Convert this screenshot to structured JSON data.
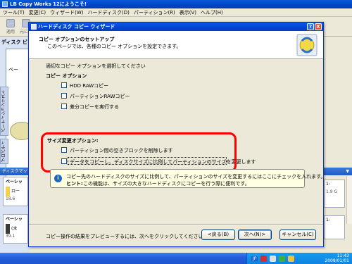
{
  "app": {
    "title": "LB Copy Works 12にようこそ!",
    "menu": [
      "ツール(T)",
      "変更(C)",
      "ウィザード(W)",
      "ハードディスク(D)",
      "パーティション(R)",
      "表示(V)",
      "ヘルプ(H)"
    ],
    "toolbar": {
      "apply": "適用",
      "undo": "元に戻"
    },
    "left_heading": "ディスク ビ",
    "side_tabs": {
      "partition_list": "パーティションリスト",
      "properties": "プロパティ"
    },
    "panel_snippet": "ベー",
    "disk_map_label": "ディスクマップ",
    "basic_disk_1": {
      "header": "ベーシッ",
      "size": "18.6",
      "label": "ロー"
    },
    "basic_disk_2": {
      "header": "ベーシッ",
      "size": "39.1",
      "label": "(未"
    },
    "right_card_1": {
      "label": "1:",
      "size": "1.9 G"
    },
    "right_card_2": {
      "label": "1:",
      "size": ""
    }
  },
  "taskbar": {
    "lang": "JP",
    "clock_line1": "11:43",
    "clock_line2": "2008/01/01"
  },
  "wizard": {
    "title": "ハードディスク コピー ウィザード",
    "header_title": "コピー オプションのセットアップ",
    "header_subtitle": "このページでは、各種のコピー オプションを設定できます。",
    "prompt": "適切なコピー オプションを選択してください",
    "copy_options_heading": "コピー オプション",
    "opt_hdd_raw": "HDD RAWコピー",
    "opt_partition_raw": "パーティションRAWコピー",
    "opt_diff_copy": "差分コピーを実行する",
    "resize_heading": "サイズ変更オプション:",
    "opt_remove_free_blocks": "パーティション間の空きブロックを削除します",
    "opt_proportional_resize": "データをコピーし、ディスクサイズに比例してパーティションのサイズを変更します",
    "tip_line1": "コピー先のハードディスクのサイズに比例して、パーティションのサイズを変更するにはここにチェックを入れます。",
    "tip_hint_label": "ヒント:",
    "tip_hint_text": "この機能は、サイズの大きなハードディスクにコピーを行う際に便利です。",
    "footer_prompt": "コピー操作の結果をプレビューするには、次へをクリックしてください",
    "back_button": "<戻る(B)",
    "next_button": "次へ(N)>",
    "cancel_button": "キャンセル(C)",
    "help_glyph": "?",
    "close_glyph": "X",
    "checkbox_states": {
      "hdd_raw": false,
      "partition_raw": false,
      "diff_copy": false,
      "remove_free_blocks": false,
      "proportional_resize": false
    }
  }
}
